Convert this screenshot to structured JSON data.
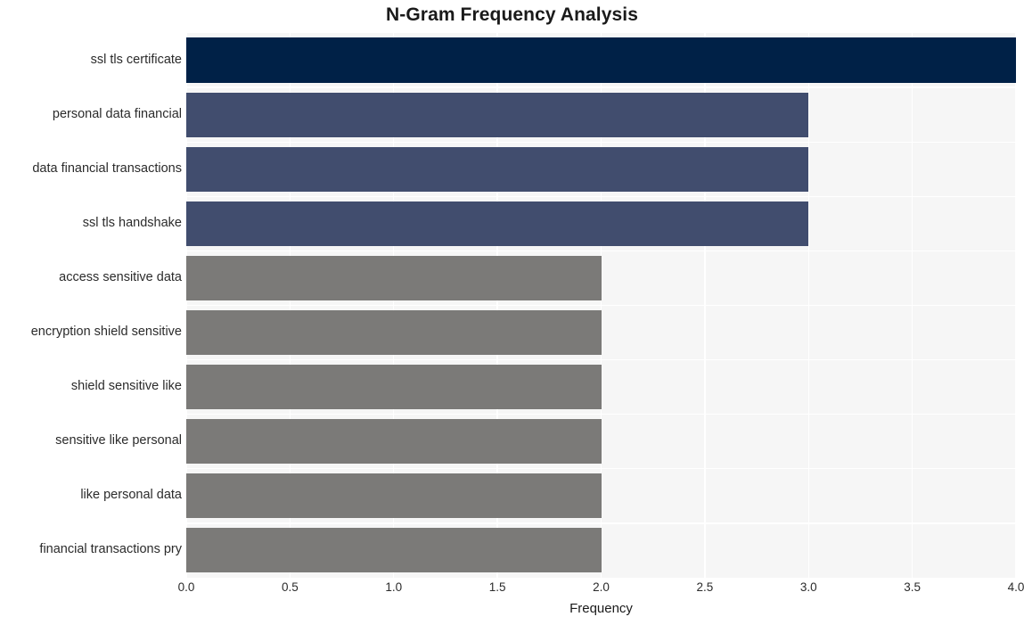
{
  "chart_data": {
    "type": "bar",
    "orientation": "horizontal",
    "title": "N-Gram Frequency Analysis",
    "xlabel": "Frequency",
    "ylabel": "",
    "categories": [
      "ssl tls certificate",
      "personal data financial",
      "data financial transactions",
      "ssl tls handshake",
      "access sensitive data",
      "encryption shield sensitive",
      "shield sensitive like",
      "sensitive like personal",
      "like personal data",
      "financial transactions pry"
    ],
    "values": [
      4,
      3,
      3,
      3,
      2,
      2,
      2,
      2,
      2,
      2
    ],
    "bar_colors": [
      "#002147",
      "#414d6e",
      "#414d6e",
      "#414d6e",
      "#7b7a78",
      "#7b7a78",
      "#7b7a78",
      "#7b7a78",
      "#7b7a78",
      "#7b7a78"
    ],
    "xlim": [
      0.0,
      4.0
    ],
    "xticks": [
      0.0,
      0.5,
      1.0,
      1.5,
      2.0,
      2.5,
      3.0,
      3.5,
      4.0
    ],
    "xtick_labels": [
      "0.0",
      "0.5",
      "1.0",
      "1.5",
      "2.0",
      "2.5",
      "3.0",
      "3.5",
      "4.0"
    ],
    "grid": true,
    "grid_color": "#ffffff",
    "plot_background": "#f6f6f6",
    "figure_background": "#ffffff",
    "legend": null
  }
}
